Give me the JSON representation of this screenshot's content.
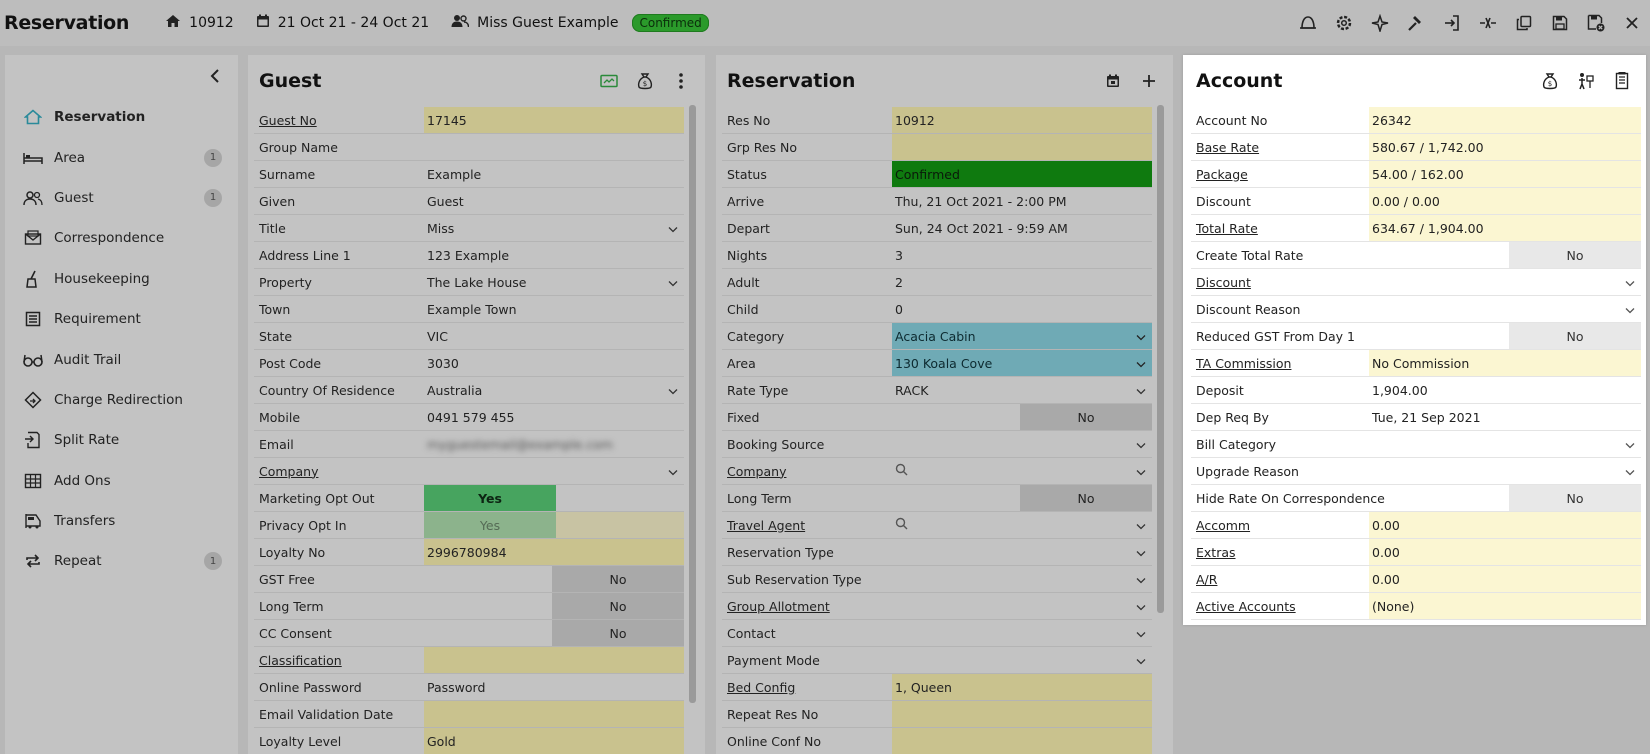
{
  "app": {
    "title": "Reservation",
    "res_no": "10912",
    "dates": "21 Oct 21  -  24 Oct 21",
    "guest": "Miss Guest Example",
    "status": "Confirmed"
  },
  "toolbar_icons": [
    "bell-icon",
    "gear-icon",
    "sparkle-icon",
    "hammer-icon",
    "check-in-icon",
    "split-icon",
    "copy-icon",
    "save-icon",
    "save-close-icon",
    "close-icon"
  ],
  "sidebar": {
    "items": [
      {
        "label": "Reservation",
        "icon": "home-icon",
        "count": ""
      },
      {
        "label": "Area",
        "icon": "bed-icon",
        "count": "1"
      },
      {
        "label": "Guest",
        "icon": "users-icon",
        "count": "1"
      },
      {
        "label": "Correspondence",
        "icon": "mail-icon",
        "count": ""
      },
      {
        "label": "Housekeeping",
        "icon": "broom-icon",
        "count": ""
      },
      {
        "label": "Requirement",
        "icon": "list-icon",
        "count": ""
      },
      {
        "label": "Audit Trail",
        "icon": "glasses-icon",
        "count": ""
      },
      {
        "label": "Charge Redirection",
        "icon": "diamond-arrow-icon",
        "count": ""
      },
      {
        "label": "Split Rate",
        "icon": "split-rate-icon",
        "count": ""
      },
      {
        "label": "Add Ons",
        "icon": "grid-icon",
        "count": ""
      },
      {
        "label": "Transfers",
        "icon": "bus-icon",
        "count": ""
      },
      {
        "label": "Repeat",
        "icon": "repeat-icon",
        "count": "1"
      }
    ]
  },
  "guest_panel": {
    "title": "Guest",
    "rows": [
      {
        "label": "Guest No",
        "value": "17145"
      },
      {
        "label": "Group Name",
        "value": ""
      },
      {
        "label": "Surname",
        "value": "Example"
      },
      {
        "label": "Given",
        "value": "Guest"
      },
      {
        "label": "Title",
        "value": "Miss"
      },
      {
        "label": "Address Line 1",
        "value": "123 Example"
      },
      {
        "label": "Property",
        "value": "The Lake House"
      },
      {
        "label": "Town",
        "value": "Example Town"
      },
      {
        "label": "State",
        "value": "VIC"
      },
      {
        "label": "Post Code",
        "value": "3030"
      },
      {
        "label": "Country Of Residence",
        "value": "Australia"
      },
      {
        "label": "Mobile",
        "value": "0491 579 455"
      },
      {
        "label": "Email",
        "value": "myguestemail@example.com"
      },
      {
        "label": "Company",
        "value": ""
      },
      {
        "label": "Marketing Opt Out",
        "value": "Yes"
      },
      {
        "label": "Privacy Opt In",
        "value": "Yes"
      },
      {
        "label": "Loyalty No",
        "value": "2996780984"
      },
      {
        "label": "GST Free",
        "value": "No"
      },
      {
        "label": "Long Term",
        "value": "No"
      },
      {
        "label": "CC Consent",
        "value": "No"
      },
      {
        "label": "Classification",
        "value": ""
      },
      {
        "label": "Online Password",
        "value": "Password"
      },
      {
        "label": "Email Validation Date",
        "value": ""
      },
      {
        "label": "Loyalty Level",
        "value": "Gold"
      }
    ]
  },
  "res_panel": {
    "title": "Reservation",
    "rows": [
      {
        "label": "Res No",
        "value": "10912"
      },
      {
        "label": "Grp Res No",
        "value": ""
      },
      {
        "label": "Status",
        "value": "Confirmed"
      },
      {
        "label": "Arrive",
        "value": "Thu, 21 Oct 2021 - 2:00 PM"
      },
      {
        "label": "Depart",
        "value": "Sun, 24 Oct 2021 - 9:59 AM"
      },
      {
        "label": "Nights",
        "value": "3"
      },
      {
        "label": "Adult",
        "value": "2"
      },
      {
        "label": "Child",
        "value": "0"
      },
      {
        "label": "Category",
        "value": "Acacia Cabin"
      },
      {
        "label": "Area",
        "value": "130 Koala Cove"
      },
      {
        "label": "Rate Type",
        "value": "RACK"
      },
      {
        "label": "Fixed",
        "value": "No"
      },
      {
        "label": "Booking Source",
        "value": ""
      },
      {
        "label": "Company",
        "value": ""
      },
      {
        "label": "Long Term",
        "value": "No"
      },
      {
        "label": "Travel Agent",
        "value": ""
      },
      {
        "label": "Reservation Type",
        "value": ""
      },
      {
        "label": "Sub Reservation Type",
        "value": ""
      },
      {
        "label": "Group Allotment",
        "value": ""
      },
      {
        "label": "Contact",
        "value": ""
      },
      {
        "label": "Payment Mode",
        "value": ""
      },
      {
        "label": "Bed Config",
        "value": "1, Queen"
      },
      {
        "label": "Repeat Res No",
        "value": ""
      },
      {
        "label": "Online Conf No",
        "value": ""
      }
    ]
  },
  "acct_panel": {
    "title": "Account",
    "rows": [
      {
        "label": "Account No",
        "value": "26342"
      },
      {
        "label": "Base Rate",
        "value": "580.67 / 1,742.00"
      },
      {
        "label": "Package",
        "value": "54.00 / 162.00"
      },
      {
        "label": "Discount",
        "value": "0.00 / 0.00"
      },
      {
        "label": "Total Rate",
        "value": "634.67 / 1,904.00"
      },
      {
        "label": "Create Total Rate",
        "value": "No"
      },
      {
        "label": "Discount",
        "value": ""
      },
      {
        "label": "Discount Reason",
        "value": ""
      },
      {
        "label": "Reduced GST From Day 1",
        "value": "No"
      },
      {
        "label": "TA Commission",
        "value": "No Commission"
      },
      {
        "label": "Deposit",
        "value": "1,904.00"
      },
      {
        "label": "Dep Req By",
        "value": "Tue, 21 Sep 2021"
      },
      {
        "label": "Bill Category",
        "value": ""
      },
      {
        "label": "Upgrade Reason",
        "value": ""
      },
      {
        "label": "Hide Rate On Correspondence",
        "value": "No"
      },
      {
        "label": "Accomm",
        "value": "0.00"
      },
      {
        "label": "Extras",
        "value": "0.00"
      },
      {
        "label": "A/R",
        "value": "0.00"
      },
      {
        "label": "Active Accounts",
        "value": "(None)"
      }
    ]
  },
  "colors": {
    "confirmed": "#0f7a0f",
    "readonly_yellow": "#c9c28e",
    "highlight_teal": "#6faab5",
    "opt_out_green": "#47a45f"
  }
}
